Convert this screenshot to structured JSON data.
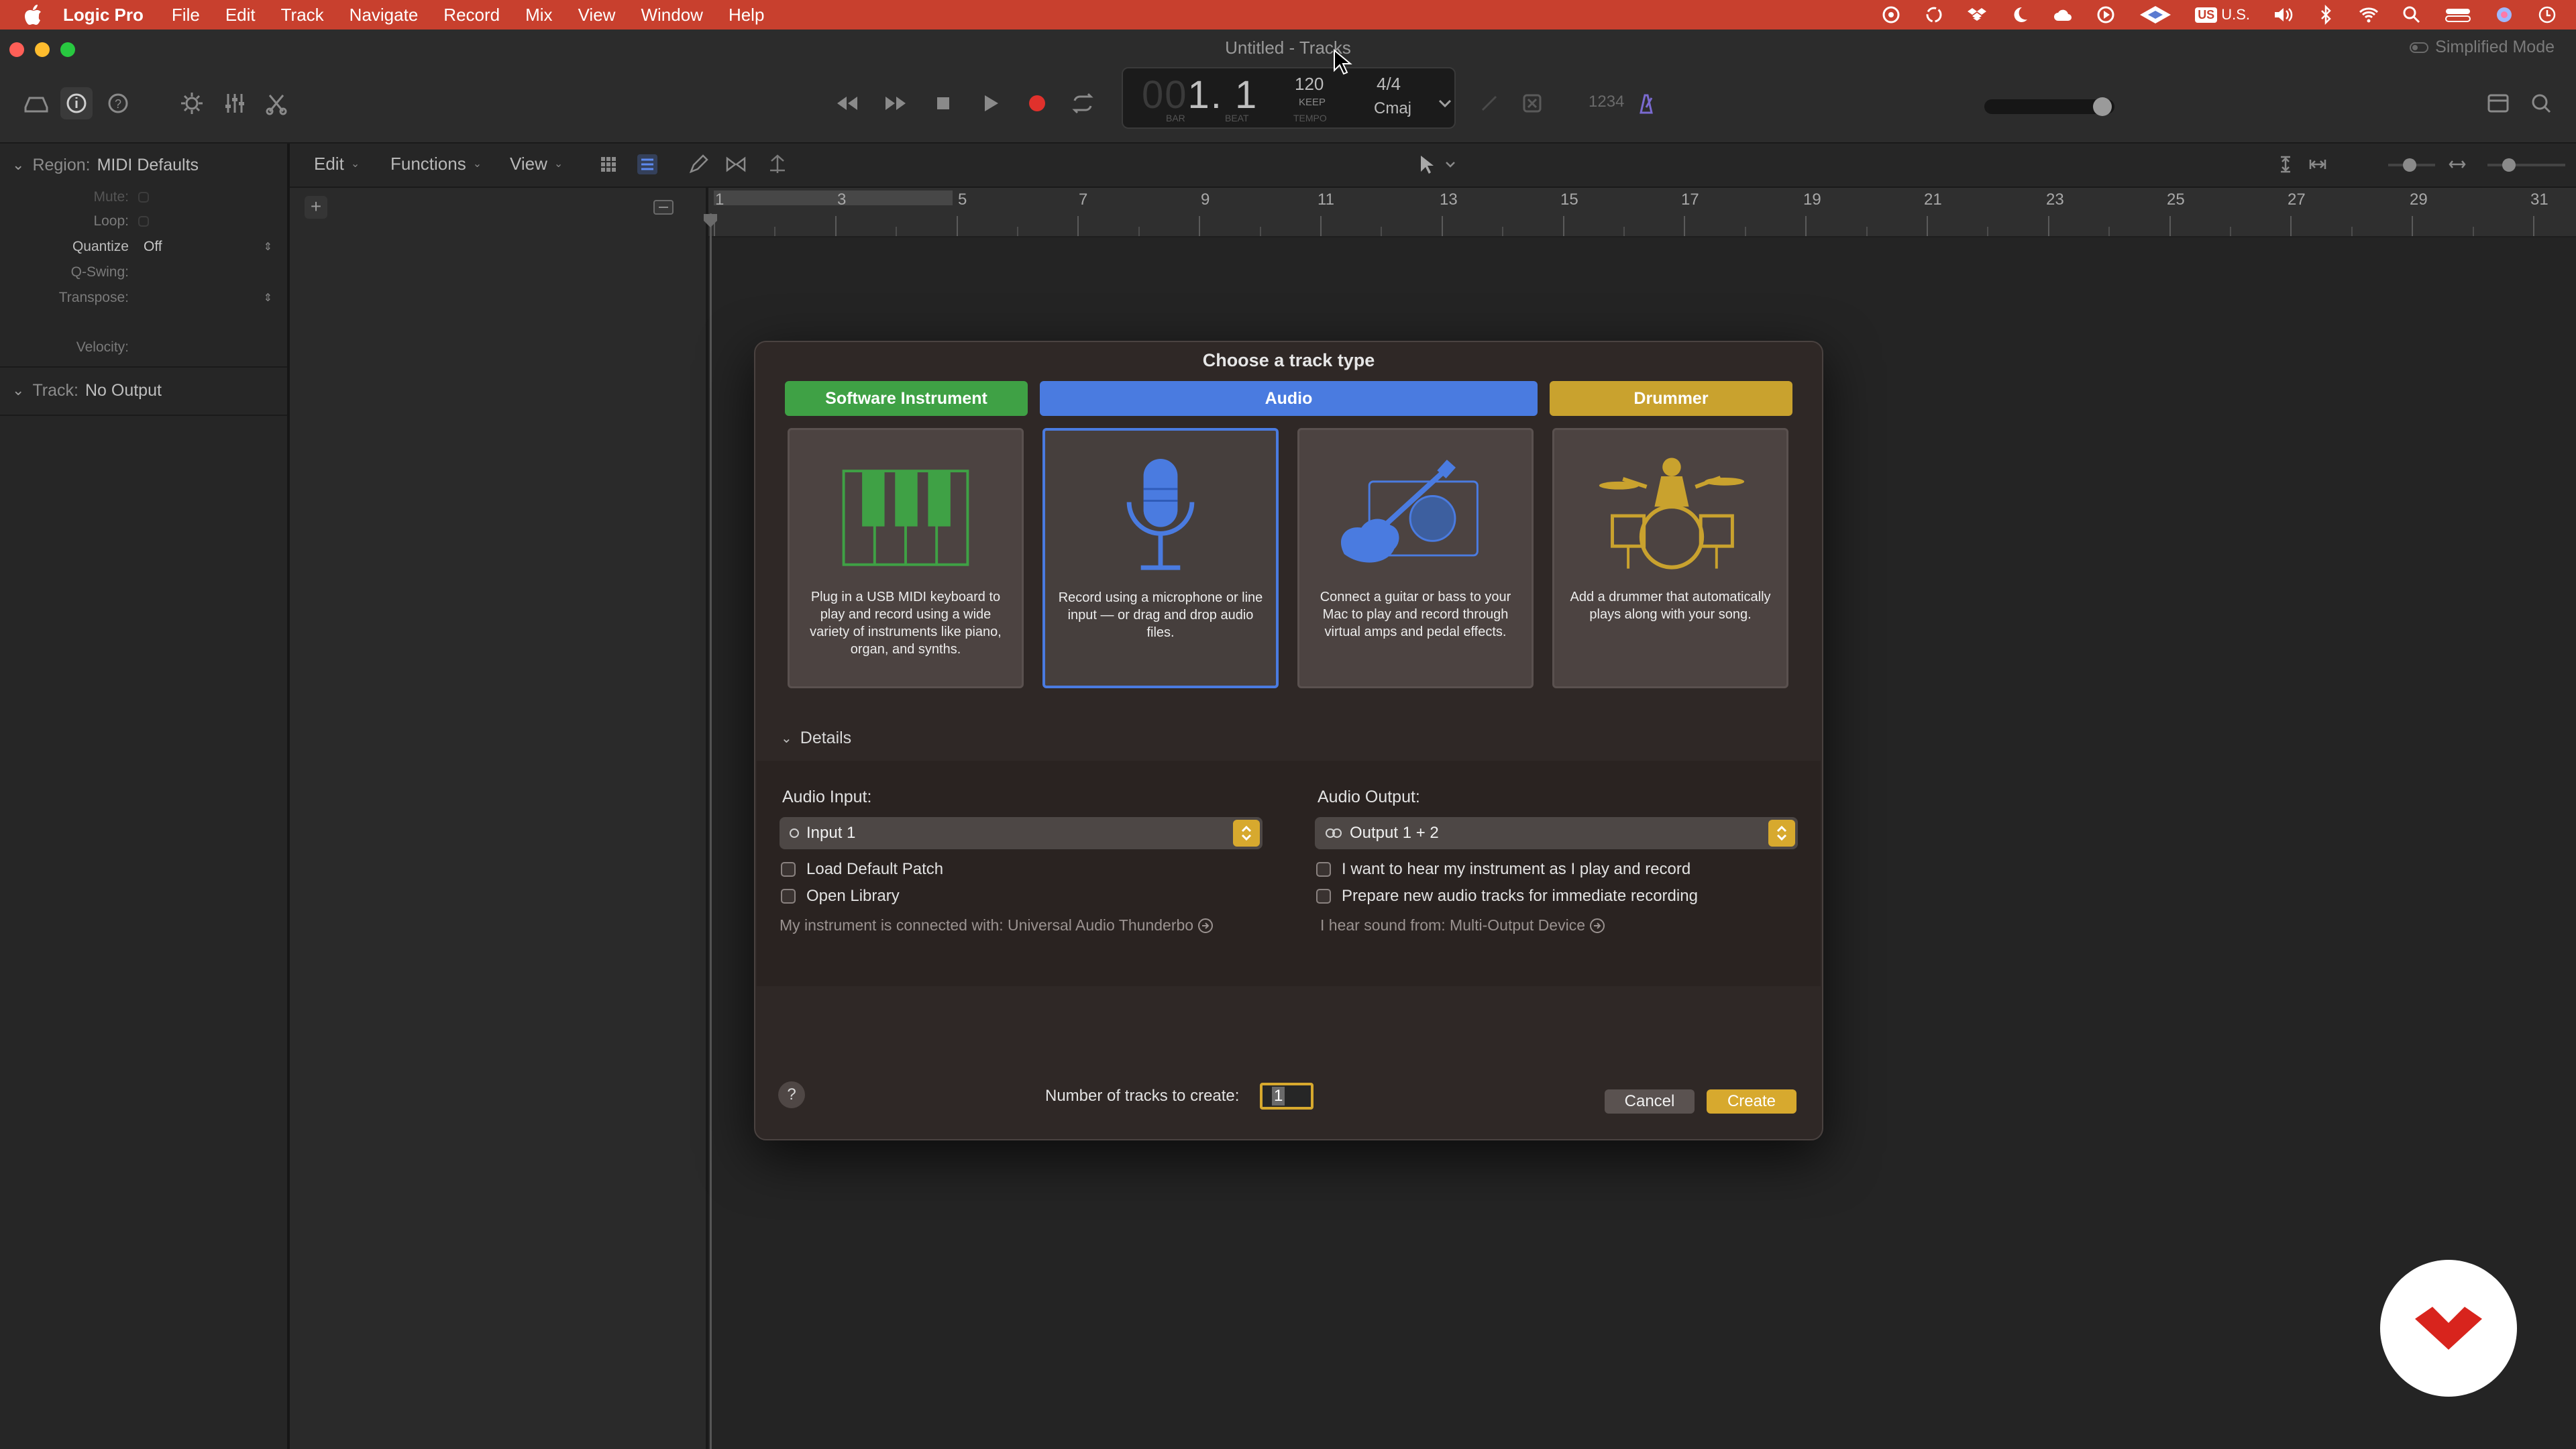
{
  "menubar": {
    "app_name": "Logic Pro",
    "items": [
      "File",
      "Edit",
      "Track",
      "Navigate",
      "Record",
      "Mix",
      "View",
      "Window",
      "Help"
    ],
    "status": {
      "input_source_badge": "US",
      "input_source": "U.S.",
      "icons": [
        "creative-cloud-icon",
        "sync-icon",
        "dropbox-icon",
        "moon-icon",
        "cloud-icon",
        "play-circle-icon",
        "uad-icon",
        "keyboard-icon",
        "volume-icon",
        "bluetooth-icon",
        "wifi-icon",
        "spotlight-icon",
        "control-center-icon",
        "siri-icon",
        "clock-icon"
      ]
    }
  },
  "window": {
    "title": "Untitled - Tracks",
    "mode_label": "Simplified Mode"
  },
  "lcd": {
    "position_bar_dim": "00",
    "position_bar": "1",
    "position_beat": "1",
    "bar_label": "BAR",
    "beat_label": "BEAT",
    "tempo": "120",
    "tempo_mode": "KEEP",
    "tempo_label": "TEMPO",
    "time_signature": "4/4",
    "key": "Cmaj"
  },
  "controlbar": {
    "count_in": "1234"
  },
  "inspector": {
    "region_label": "Region:",
    "region_name": "MIDI Defaults",
    "rows": [
      {
        "key": "Mute:",
        "value": ""
      },
      {
        "key": "Loop:",
        "value": ""
      },
      {
        "key": "Quantize",
        "value": "Off"
      },
      {
        "key": "Q-Swing:",
        "value": ""
      },
      {
        "key": "Transpose:",
        "value": ""
      },
      {
        "key": "Velocity:",
        "value": ""
      }
    ],
    "track_label": "Track:",
    "track_name": "No Output"
  },
  "track_toolbar": {
    "edit": "Edit",
    "functions": "Functions",
    "view": "View"
  },
  "ruler": {
    "marks": [
      "1",
      "3",
      "5",
      "7",
      "9",
      "11",
      "13",
      "15",
      "17",
      "19",
      "21",
      "23",
      "25",
      "27",
      "29",
      "31"
    ]
  },
  "dialog": {
    "title": "Choose a track type",
    "tabs": [
      {
        "label": "Software Instrument",
        "color": "#3fa145"
      },
      {
        "label": "Audio",
        "color": "#4a7be0"
      },
      {
        "label": "Drummer",
        "color": "#c9a22e"
      }
    ],
    "cards": [
      {
        "icon": "piano-keyboard-icon",
        "description": "Plug in a USB MIDI keyboard to play and record using a wide variety of instruments like piano, organ, and synths."
      },
      {
        "icon": "microphone-icon",
        "description": "Record using a microphone or line input — or drag and drop audio files."
      },
      {
        "icon": "guitar-amp-icon",
        "description": "Connect a guitar or bass to your Mac to play and record through virtual amps and pedal effects."
      },
      {
        "icon": "drummer-icon",
        "description": "Add a drummer that automatically plays along with your song."
      }
    ],
    "selected_card": "Audio",
    "details_label": "Details",
    "audio_input_label": "Audio Input:",
    "audio_input_value": "Input 1",
    "audio_output_label": "Audio Output:",
    "audio_output_value": "Output 1 + 2",
    "left_checks": [
      "Load Default Patch",
      "Open Library"
    ],
    "right_checks": [
      "I want to hear my instrument as I play and record",
      "Prepare new audio tracks for immediate recording"
    ],
    "instrument_connected": "My instrument is connected with: Universal Audio Thunderbo",
    "hear_sound_from": "I hear sound from: Multi-Output Device",
    "number_label": "Number of tracks to create:",
    "number_value": "1",
    "cancel_label": "Cancel",
    "create_label": "Create",
    "help_label": "?"
  },
  "colors": {
    "menubar": "#c8402e",
    "accent_yellow": "#d7a92e",
    "audio_blue": "#4a7be0",
    "instrument_green": "#3fa145",
    "drummer_gold": "#c9a22e"
  }
}
